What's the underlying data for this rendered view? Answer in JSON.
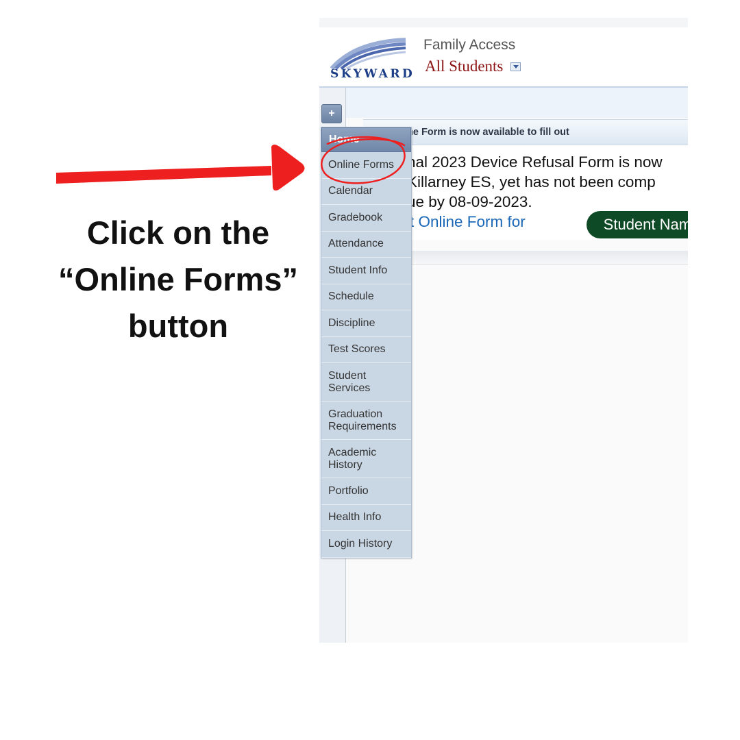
{
  "instruction": {
    "lines": [
      "Click on the",
      "“Online Forms”",
      "button"
    ],
    "arrow_color": "#ee1f1f"
  },
  "app": {
    "logo_text": "SKYWARD",
    "title": "Family Access",
    "student_selector": "All Students"
  },
  "toolbar": {
    "add_label": "+"
  },
  "message": {
    "header": "ne Form is now available to fill out",
    "body_lines": [
      "nal 2023 Device Refusal Form is now",
      "Killarney ES, yet has not been comp",
      "ue by 08-09-2023."
    ],
    "link_text": "t Online Form for",
    "student_name": "Student Name",
    "faded_text": "nal 2023 Device Refusal Form is"
  },
  "nav": {
    "items": [
      "Home",
      "Online Forms",
      "Calendar",
      "Gradebook",
      "Attendance",
      "Student Info",
      "Schedule",
      "Discipline",
      "Test Scores",
      "Student Services",
      "Graduation Requirements",
      "Academic History",
      "Portfolio",
      "Health Info",
      "Login History"
    ]
  },
  "colors": {
    "annotation_red": "#ee1f1f",
    "nav_bg": "#c9d6e4",
    "home_bg": "#7a90b0",
    "link_blue": "#1a67b8",
    "pill_green": "#0f4a26",
    "student_red": "#8b1212"
  },
  "icons": {
    "arrow": "red-arrow-right",
    "circle": "red-hand-drawn-circle",
    "picker": "dropdown-arrow-icon",
    "logo": "skyward-swoosh-logo"
  }
}
